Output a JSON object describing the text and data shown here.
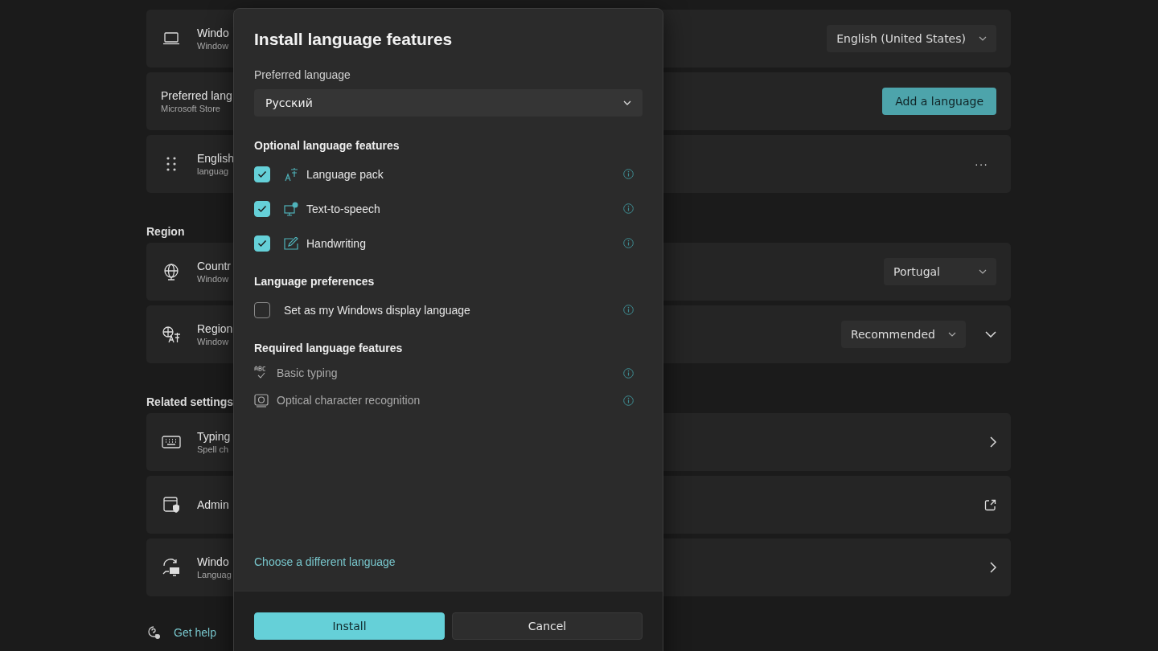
{
  "settings": {
    "sections": [
      {
        "cards": [
          {
            "title": "Windo",
            "subtitle": "Window",
            "control": {
              "kind": "dropdown",
              "value": "English (United States)"
            }
          },
          {
            "title": "Preferred lang",
            "subtitle": "Microsoft Store",
            "control": {
              "kind": "button",
              "label": "Add a language"
            }
          },
          {
            "title": "English",
            "subtitle": "languag",
            "control": {
              "kind": "more",
              "label": "···"
            }
          }
        ]
      },
      {
        "heading": "Region",
        "cards": [
          {
            "title": "Countr",
            "subtitle": "Window",
            "control": {
              "kind": "dropdown",
              "value": "Portugal"
            }
          },
          {
            "title": "Region",
            "subtitle": "Window",
            "control": {
              "kind": "dropdown-expand",
              "value": "Recommended"
            }
          }
        ]
      },
      {
        "heading": "Related settings",
        "cards": [
          {
            "title": "Typing",
            "subtitle": "Spell ch",
            "control": {
              "kind": "chevron"
            }
          },
          {
            "title": "Admin",
            "control": {
              "kind": "external"
            }
          },
          {
            "title": "Windo",
            "subtitle": "Languag",
            "control": {
              "kind": "chevron"
            }
          }
        ]
      }
    ],
    "help_link": "Get help"
  },
  "dialog": {
    "title": "Install language features",
    "preferred_language": {
      "label": "Preferred language",
      "value": "Русский"
    },
    "sections": [
      {
        "heading": "Optional language features",
        "items": [
          {
            "kind": "checkbox",
            "label": "Language pack",
            "checked": true
          },
          {
            "kind": "checkbox",
            "label": "Text-to-speech",
            "checked": true
          },
          {
            "kind": "checkbox",
            "label": "Handwriting",
            "checked": true
          }
        ]
      },
      {
        "heading": "Language preferences",
        "items": [
          {
            "kind": "option",
            "label": "Set as my Windows display language",
            "checked": false
          }
        ]
      },
      {
        "heading": "Required language features",
        "items": [
          {
            "kind": "required",
            "label": "Basic typing"
          },
          {
            "kind": "required",
            "label": "Optical character recognition"
          }
        ]
      }
    ],
    "link": "Choose a different language",
    "buttons": [
      {
        "label": "Install",
        "primary": true
      },
      {
        "label": "Cancel",
        "primary": false
      }
    ]
  }
}
